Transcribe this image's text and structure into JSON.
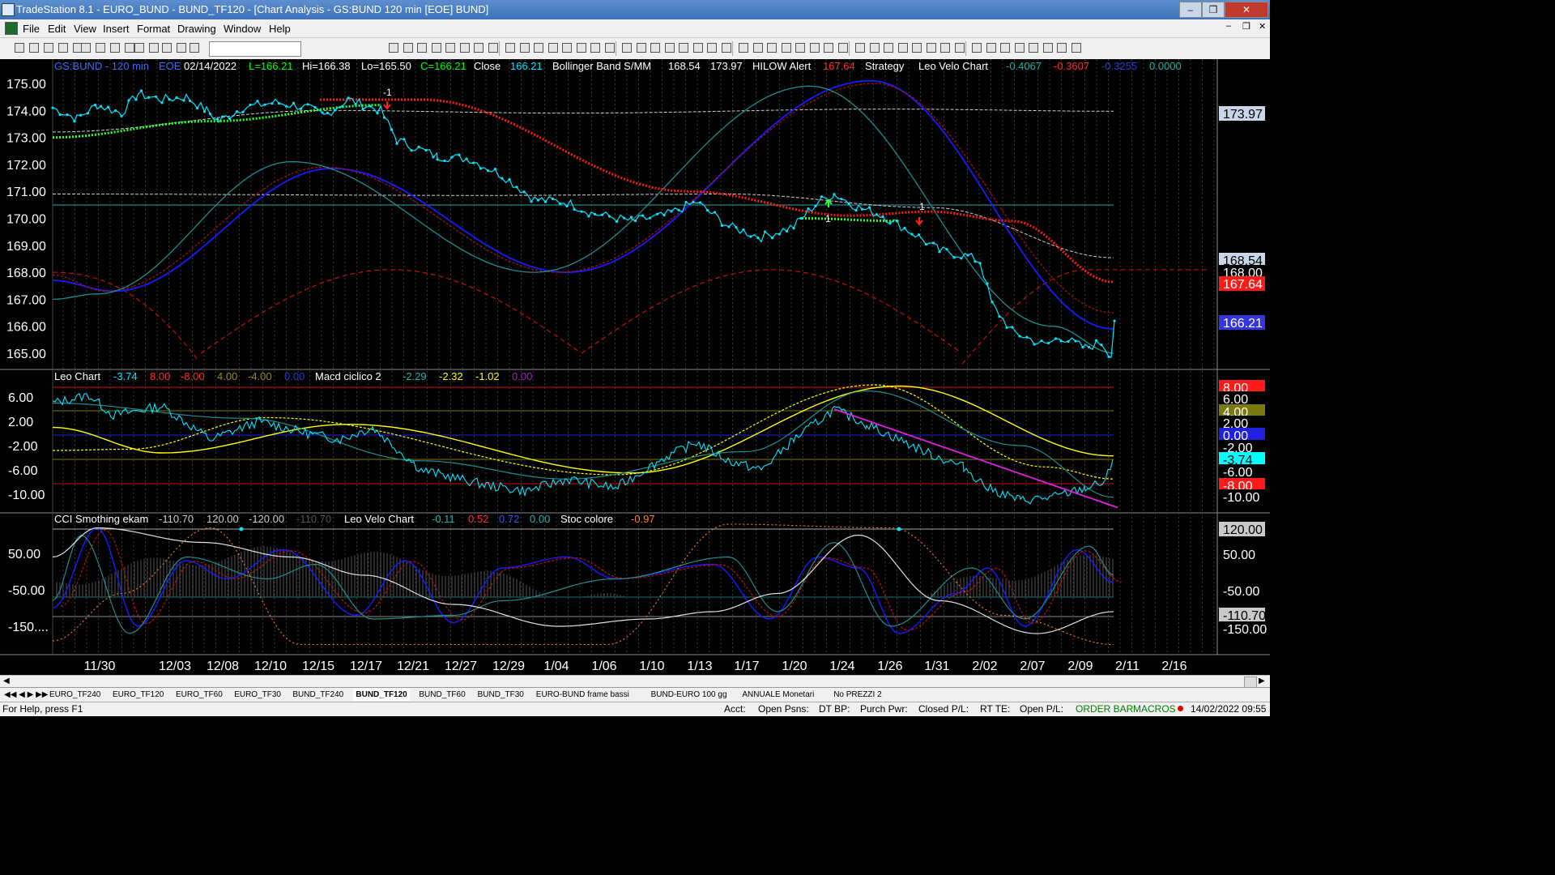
{
  "window": {
    "title": "TradeStation 8.1 - EURO_BUND - BUND_TF120 - [Chart Analysis - GS:BUND  120 min  [EOE] BUND]",
    "min": "–",
    "max": "❒",
    "close": "✕"
  },
  "menu": [
    "File",
    "Edit",
    "View",
    "Insert",
    "Format",
    "Drawing",
    "Window",
    "Help"
  ],
  "mdi": {
    "min": "–",
    "restore": "❒",
    "close": "✕"
  },
  "panes": {
    "price": {
      "header": [
        {
          "t": "GS:BUND - 120 min",
          "c": "#3a6cf0"
        },
        {
          "t": "EOE",
          "c": "#3a6cf0"
        },
        {
          "t": "02/14/2022",
          "c": "#ffffff"
        },
        {
          "t": "L=166.21",
          "c": "#00ff00"
        },
        {
          "t": "Hi=166.38",
          "c": "#ffffff"
        },
        {
          "t": "Lo=165.50",
          "c": "#ffffff"
        },
        {
          "t": "C=166.21",
          "c": "#00ff00"
        },
        {
          "t": "Close",
          "c": "#ffffff"
        },
        {
          "t": "166.21",
          "c": "#00e5ff"
        },
        {
          "t": "Bollinger Band S/MM",
          "c": "#ffffff"
        },
        {
          "t": "168.54",
          "c": "#ffffff"
        },
        {
          "t": "173.97",
          "c": "#ffffff"
        },
        {
          "t": "HILOW Alert",
          "c": "#ffffff"
        },
        {
          "t": "167.64",
          "c": "#ff2a2a"
        },
        {
          "t": "Strategy",
          "c": "#ffffff"
        },
        {
          "t": "Leo Velo Chart",
          "c": "#ffffff"
        },
        {
          "t": "-0.4067",
          "c": "#20b2aa"
        },
        {
          "t": "-0.3607",
          "c": "#ff2a2a"
        },
        {
          "t": "-0.3255",
          "c": "#2c3ccf"
        },
        {
          "t": "0.0000",
          "c": "#20b2aa"
        }
      ],
      "ticks": [
        "175.00",
        "174.00",
        "173.00",
        "172.00",
        "171.00",
        "170.00",
        "169.00",
        "168.00",
        "167.00",
        "166.00",
        "165.00"
      ],
      "markers": [
        {
          "t": "173.97",
          "bg": "#c9d6ea",
          "fg": "#000000"
        },
        {
          "t": "168.54",
          "bg": "#c9d6ea",
          "fg": "#000000"
        },
        {
          "t": "168.00",
          "bg": "#000000",
          "fg": "#ffffff"
        },
        {
          "t": "167.64",
          "bg": "#ff1a1a",
          "fg": "#ffffff"
        },
        {
          "t": "166.21",
          "bg": "#3535e0",
          "fg": "#ffffff"
        }
      ],
      "signals": [
        "-1",
        "1",
        "1"
      ]
    },
    "macd": {
      "header": [
        {
          "t": "Leo Chart",
          "c": "#ffffff"
        },
        {
          "t": "-3.74",
          "c": "#00e5ff"
        },
        {
          "t": "8.00",
          "c": "#ff2a2a"
        },
        {
          "t": "-8.00",
          "c": "#ff2a2a"
        },
        {
          "t": "4.00",
          "c": "#9a8a20"
        },
        {
          "t": "-4.00",
          "c": "#9a8a20"
        },
        {
          "t": "0.00",
          "c": "#2c3ccf"
        },
        {
          "t": "Macd ciclico 2",
          "c": "#ffffff"
        },
        {
          "t": "-2.29",
          "c": "#20b2aa"
        },
        {
          "t": "-2.32",
          "c": "#ffff00"
        },
        {
          "t": "-1.02",
          "c": "#ffff00"
        },
        {
          "t": "0.00",
          "c": "#a020c0"
        }
      ],
      "ticks": [
        "6.00",
        "2.00",
        "-2.00",
        "-6.00",
        "-10.00"
      ],
      "markers": [
        {
          "t": "8.00",
          "bg": "#ff1a1a",
          "fg": "#ffffff"
        },
        {
          "t": "6.00",
          "bg": "#000000",
          "fg": "#ffffff"
        },
        {
          "t": "4.00",
          "bg": "#7a7a10",
          "fg": "#ffffff"
        },
        {
          "t": "2.00",
          "bg": "#000000",
          "fg": "#ffffff"
        },
        {
          "t": "0.00",
          "bg": "#2020e0",
          "fg": "#ffffff"
        },
        {
          "t": "-2.00",
          "bg": "#000000",
          "fg": "#ffffff"
        },
        {
          "t": "-3.74",
          "bg": "#00ffff",
          "fg": "#000000"
        },
        {
          "t": "-6.00",
          "bg": "#000000",
          "fg": "#ffffff"
        },
        {
          "t": "-8.00",
          "bg": "#ff1a1a",
          "fg": "#ffffff"
        },
        {
          "t": "-10.00",
          "bg": "#000000",
          "fg": "#ffffff"
        }
      ]
    },
    "cci": {
      "header": [
        {
          "t": "CCI Smothing ekam",
          "c": "#ffffff"
        },
        {
          "t": "-110.70",
          "c": "#cccccc"
        },
        {
          "t": "120.00",
          "c": "#cccccc"
        },
        {
          "t": "-120.00",
          "c": "#cccccc"
        },
        {
          "t": "-110.70",
          "c": "#555555"
        },
        {
          "t": "Leo Velo Chart",
          "c": "#ffffff"
        },
        {
          "t": "-0.11",
          "c": "#20b2aa"
        },
        {
          "t": "0.52",
          "c": "#ff2a2a"
        },
        {
          "t": "0.72",
          "c": "#3a50ff"
        },
        {
          "t": "0.00",
          "c": "#20b2aa"
        },
        {
          "t": "Stoc colore",
          "c": "#ffffff"
        },
        {
          "t": "-0.97",
          "c": "#ff7f2a"
        }
      ],
      "ticks": [
        "50.00",
        "-50.00",
        "-150...."
      ],
      "markers": [
        {
          "t": "120.00",
          "bg": "#c9c9c9",
          "fg": "#000000"
        },
        {
          "t": "50.00",
          "bg": "#000000",
          "fg": "#ffffff"
        },
        {
          "t": "-50.00",
          "bg": "#000000",
          "fg": "#ffffff"
        },
        {
          "t": "-110.70",
          "bg": "#c9c9c9",
          "fg": "#000000"
        },
        {
          "t": "-150.00",
          "bg": "#000000",
          "fg": "#ffffff"
        }
      ]
    }
  },
  "dates": [
    "11/30",
    "12/03",
    "12/08",
    "12/10",
    "12/15",
    "12/17",
    "12/21",
    "12/27",
    "12/29",
    "1/04",
    "1/06",
    "1/10",
    "1/13",
    "1/17",
    "1/20",
    "1/24",
    "1/26",
    "1/31",
    "2/02",
    "2/07",
    "2/09",
    "2/11",
    "2/16"
  ],
  "tabs": [
    "EURO_TF240",
    "EURO_TF120",
    "EURO_TF60",
    "EURO_TF30",
    "BUND_TF240",
    "BUND_TF120",
    "BUND_TF60",
    "BUND_TF30",
    "EURO-BUND frame bassi",
    "BUND-EURO 100 gg",
    "ANNUALE Monetari",
    "No PREZZI 2"
  ],
  "active_tab": "BUND_TF120",
  "status": {
    "help": "For Help, press F1",
    "acct": "Acct:",
    "open_psns": "Open Psns:",
    "dt_bp": "DT BP:",
    "purch_pwr": "Purch Pwr:",
    "closed_pl": "Closed P/L:",
    "rt_te": "RT TE:",
    "open_pl": "Open P/L:",
    "order_bar": "ORDER BAR",
    "macros": "MACROS",
    "datetime": "14/02/2022 09:55"
  },
  "colors": {
    "price": "#00e5ff",
    "bb_mid": "#d0d0d0",
    "ma_fast": "#1a1aff",
    "ma_slow": "#ff2020",
    "macd_fast": "#ffff00",
    "cci_white": "#e0e0e0",
    "stoc": "#ff7f2a"
  }
}
